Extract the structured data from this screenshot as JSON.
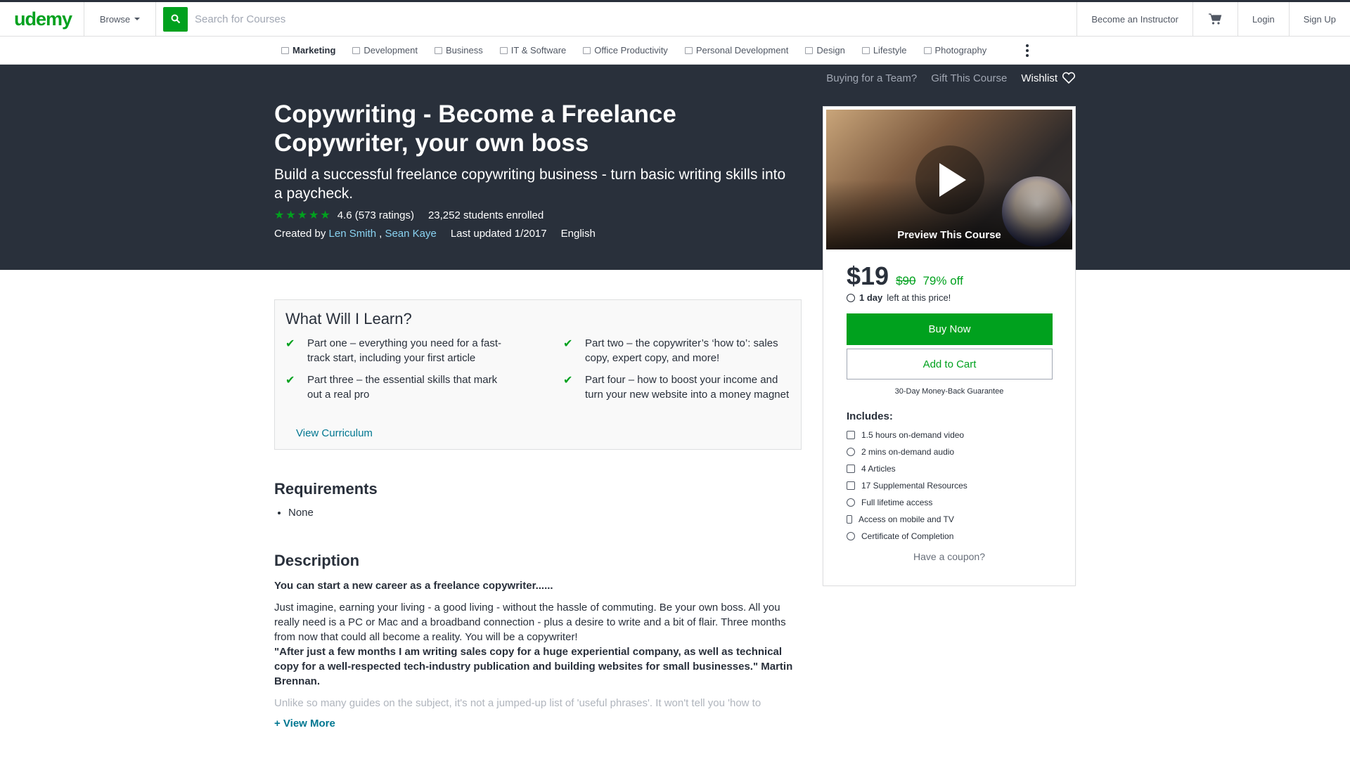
{
  "header": {
    "logo": "udemy",
    "browse_label": "Browse",
    "search_placeholder": "Search for Courses",
    "become_instructor": "Become an Instructor",
    "login": "Login",
    "signup": "Sign Up",
    "icons": [
      "search-icon",
      "cart-icon"
    ]
  },
  "categories": [
    {
      "label": "Marketing",
      "active": true
    },
    {
      "label": "Development"
    },
    {
      "label": "Business"
    },
    {
      "label": "IT & Software"
    },
    {
      "label": "Office Productivity"
    },
    {
      "label": "Personal Development"
    },
    {
      "label": "Design"
    },
    {
      "label": "Lifestyle"
    },
    {
      "label": "Photography"
    }
  ],
  "hero": {
    "buying_team": "Buying for a Team?",
    "gift": "Gift This Course",
    "wishlist": "Wishlist",
    "title": "Copywriting - Become a Freelance Copywriter, your own boss",
    "subtitle": "Build a successful freelance copywriting business - turn basic writing skills into a paycheck.",
    "rating": "4.6 (573 ratings)",
    "rating_value": 4.6,
    "students": "23,252 students enrolled",
    "created_by": "Created by",
    "author1": "Len Smith",
    "author_sep": ",",
    "author2": "Sean Kaye",
    "updated": "Last updated 1/2017",
    "language": "English"
  },
  "card": {
    "preview_label": "Preview This Course",
    "price": "$19",
    "old_price": "$90",
    "discount": "79% off",
    "time_bold": "1 day",
    "time_rest": "left at this price!",
    "buy_now": "Buy Now",
    "add_to_cart": "Add to Cart",
    "guarantee": "30-Day Money-Back Guarantee",
    "includes_title": "Includes:",
    "includes": [
      {
        "label": "1.5 hours on-demand video",
        "icon": "video-icon"
      },
      {
        "label": "2 mins on-demand audio",
        "icon": "audio-icon"
      },
      {
        "label": "4 Articles",
        "icon": "article-icon"
      },
      {
        "label": "17 Supplemental Resources",
        "icon": "resources-icon"
      },
      {
        "label": "Full lifetime access",
        "icon": "lifetime-icon"
      },
      {
        "label": "Access on mobile and TV",
        "icon": "mobile-icon"
      },
      {
        "label": "Certificate of Completion",
        "icon": "certificate-icon"
      }
    ],
    "coupon": "Have a coupon?"
  },
  "learn": {
    "title": "What Will I Learn?",
    "items": [
      "Part one – everything you need for a fast-track start, including your first article",
      "Part two – the copywriter’s ‘how to’: sales copy, expert copy, and more!",
      "Part three – the essential skills that mark out a real pro",
      "Part four – how to boost your income and turn your new website into a money magnet"
    ],
    "view_curriculum": "View Curriculum"
  },
  "requirements": {
    "title": "Requirements",
    "items": [
      "None"
    ]
  },
  "description": {
    "title": "Description",
    "lead": "You can start a new career as a freelance copywriter......",
    "p1": "Just imagine, earning your living - a good living - without the hassle of commuting. Be your own boss. All you really need is a PC or Mac and a broadband connection - plus a desire to write and a bit of flair. Three months from now that could all become a reality. You will be a copywriter!",
    "quote": "\"After just a few months I am writing sales copy for a huge experiential company, as well as technical copy for a well-respected tech-industry publication and building websites for small businesses.\" Martin Brennan.",
    "p2": "Unlike so many guides on the subject, it's not a jumped-up list of 'useful phrases'. It won't tell you 'how to",
    "view_more": "+ View More"
  }
}
